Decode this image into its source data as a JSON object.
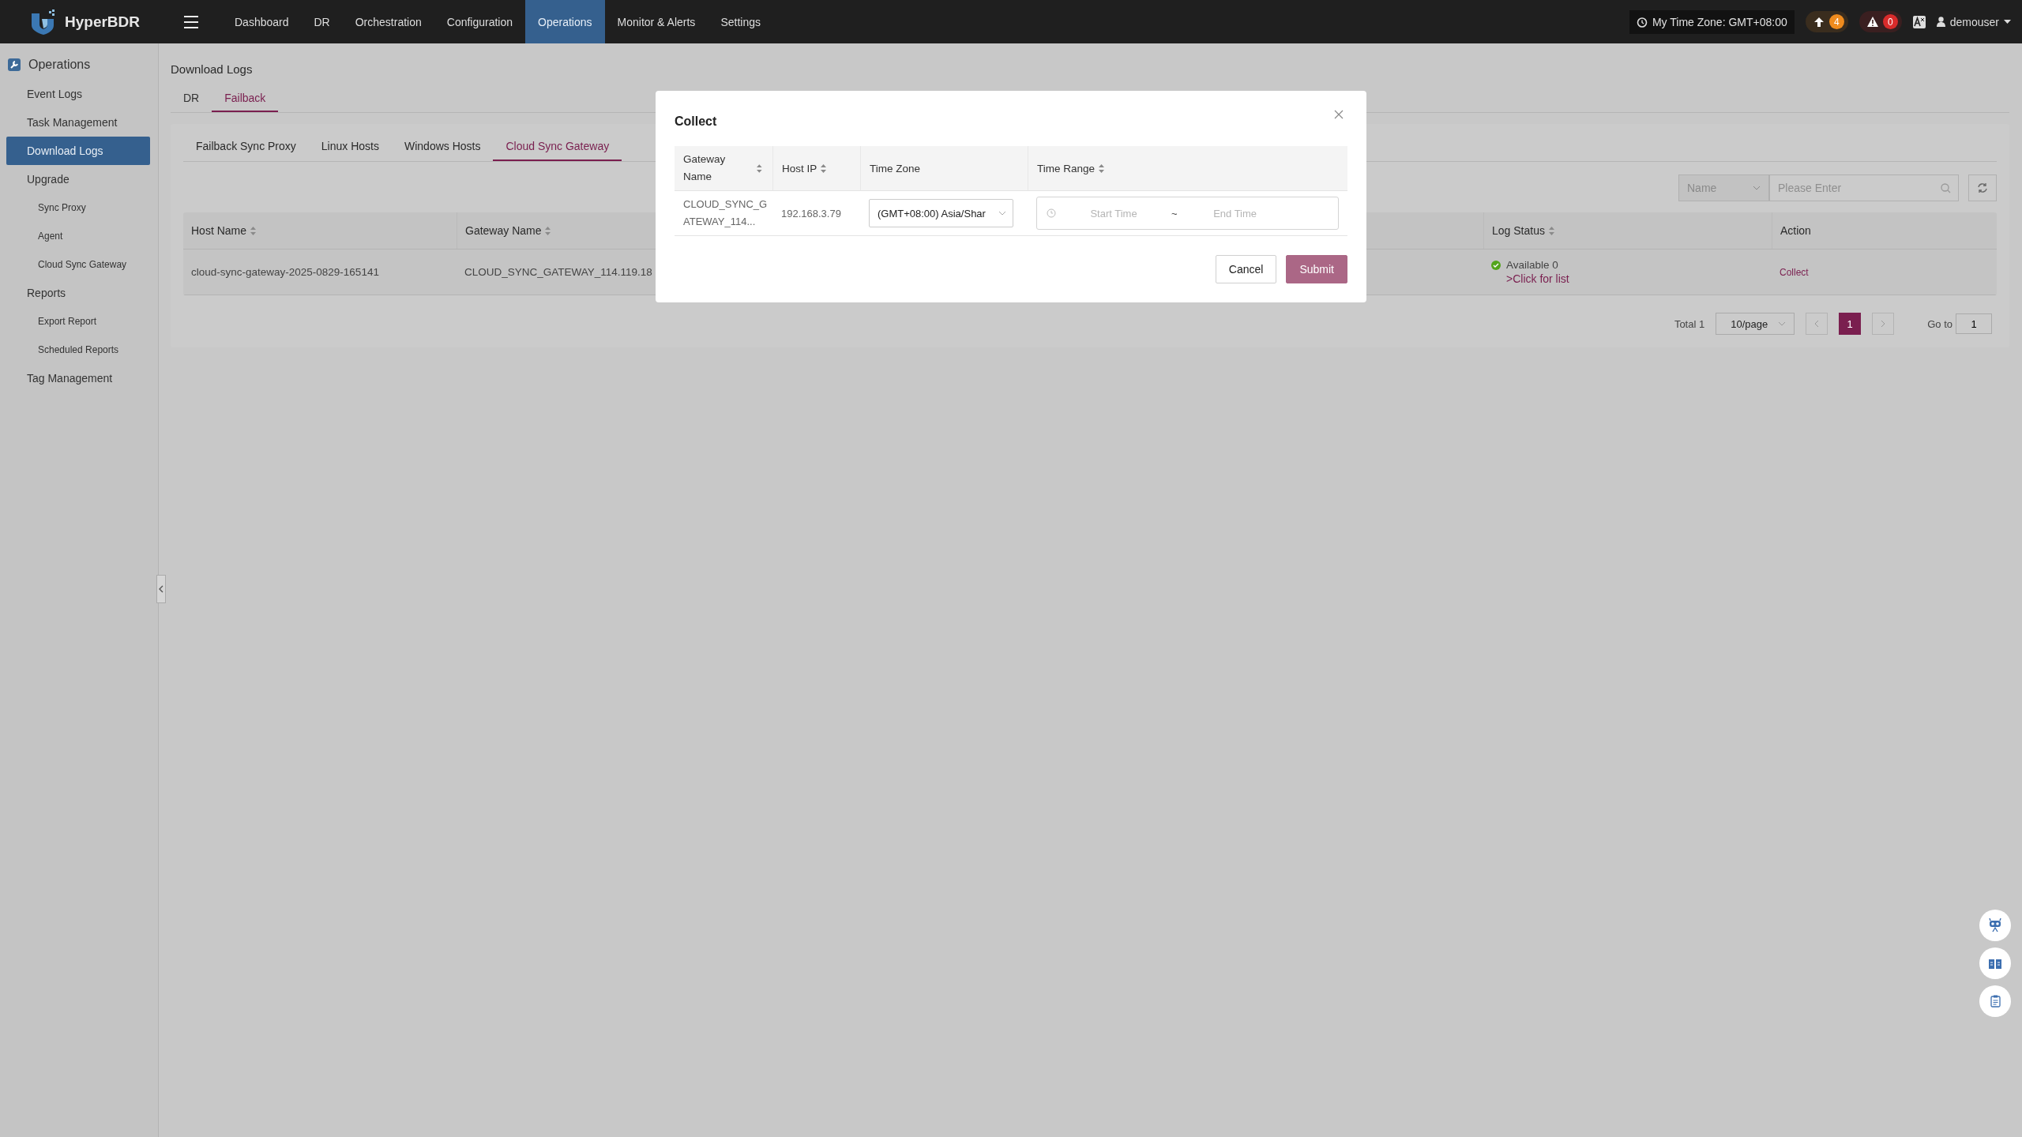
{
  "topbar": {
    "brand": "HyperBDR",
    "nav": [
      {
        "label": "Dashboard",
        "selected": false
      },
      {
        "label": "DR",
        "selected": false
      },
      {
        "label": "Orchestration",
        "selected": false
      },
      {
        "label": "Configuration",
        "selected": false
      },
      {
        "label": "Operations",
        "selected": true
      },
      {
        "label": "Monitor & Alerts",
        "selected": false
      },
      {
        "label": "Settings",
        "selected": false
      }
    ],
    "timezone": "My Time Zone: GMT+08:00",
    "upgrade_count": "4",
    "alert_count": "0",
    "user": "demouser"
  },
  "sidebar": {
    "section": "Operations",
    "items": [
      {
        "label": "Event Logs",
        "selected": false
      },
      {
        "label": "Task Management",
        "selected": false
      },
      {
        "label": "Download Logs",
        "selected": true
      },
      {
        "label": "Upgrade",
        "selected": false,
        "children": [
          {
            "label": "Sync Proxy",
            "selected": false
          },
          {
            "label": "Agent",
            "selected": false
          },
          {
            "label": "Cloud Sync Gateway",
            "selected": false
          }
        ]
      },
      {
        "label": "Reports",
        "selected": false,
        "children": [
          {
            "label": "Export Report",
            "selected": false
          },
          {
            "label": "Scheduled Reports",
            "selected": false
          }
        ]
      },
      {
        "label": "Tag Management",
        "selected": false
      }
    ]
  },
  "page_title": "Download Logs",
  "tabs": [
    {
      "label": "DR",
      "selected": false
    },
    {
      "label": "Failback",
      "selected": true
    }
  ],
  "subtabs": [
    {
      "label": "Failback Sync Proxy",
      "selected": false
    },
    {
      "label": "Linux Hosts",
      "selected": false
    },
    {
      "label": "Windows Hosts",
      "selected": false
    },
    {
      "label": "Cloud Sync Gateway",
      "selected": true
    }
  ],
  "filter": {
    "field": "Name",
    "placeholder": "Please Enter"
  },
  "table": {
    "columns": [
      {
        "label": "Host Name",
        "sortable": true
      },
      {
        "label": "Gateway Name",
        "sortable": true
      },
      {
        "label": "Log Status",
        "sortable": true
      },
      {
        "label": "Action",
        "sortable": false
      }
    ],
    "rows": [
      {
        "host_name": "cloud-sync-gateway-2025-0829-165141",
        "gateway_name": "CLOUD_SYNC_GATEWAY_114.119.18",
        "status_text": "Available 0",
        "list_link": ">Click for list",
        "action": "Collect"
      }
    ]
  },
  "pagination": {
    "total": "Total 1",
    "page_size": "10/page",
    "pages": [
      {
        "label": "1",
        "selected": true
      }
    ],
    "goto_label": "Go to",
    "goto_value": "1"
  },
  "modal": {
    "title": "Collect",
    "columns": [
      {
        "label": "Gateway Name",
        "sortable": true
      },
      {
        "label": "Host IP",
        "sortable": true
      },
      {
        "label": "Time Zone",
        "sortable": false
      },
      {
        "label": "Time Range",
        "sortable": true
      }
    ],
    "rows": [
      {
        "gateway_name": "CLOUD_SYNC_GATEWAY_114...",
        "host_ip": "192.168.3.79",
        "time_zone": "(GMT+08:00) Asia/Shar",
        "start_placeholder": "Start Time",
        "separator": "~",
        "end_placeholder": "End Time"
      }
    ],
    "buttons": [
      {
        "label": "Cancel",
        "kind": "secondary"
      },
      {
        "label": "Submit",
        "kind": "primary"
      }
    ]
  }
}
